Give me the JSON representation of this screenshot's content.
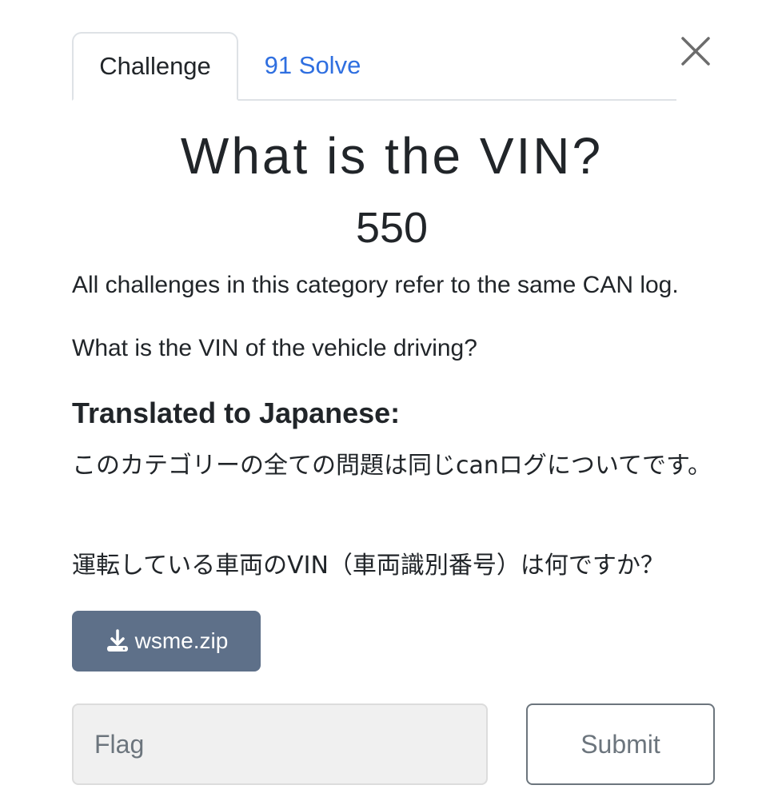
{
  "tabs": [
    {
      "label": "Challenge",
      "active": true
    },
    {
      "label": "91 Solve",
      "active": false
    }
  ],
  "challenge": {
    "title": "What is the VIN?",
    "points": "550",
    "description": [
      "All challenges in this category refer to the same CAN log.",
      "What is the VIN of the vehicle driving?"
    ],
    "translation_heading": "Translated to Japanese:",
    "translation": [
      "このカテゴリーの全ての問題は同じcanログについてです。",
      "運転している車両のVIN（車両識別番号）は何ですか？"
    ]
  },
  "file": {
    "name": "wsme.zip",
    "icon": "download-icon"
  },
  "form": {
    "flag_placeholder": "Flag",
    "flag_value": "",
    "submit_label": "Submit"
  },
  "icons": {
    "close": "close-icon"
  },
  "colors": {
    "link": "#2f6fe0",
    "file_button": "#5e7089",
    "input_bg": "#f0f0f0",
    "submit_border": "#6c757d"
  }
}
